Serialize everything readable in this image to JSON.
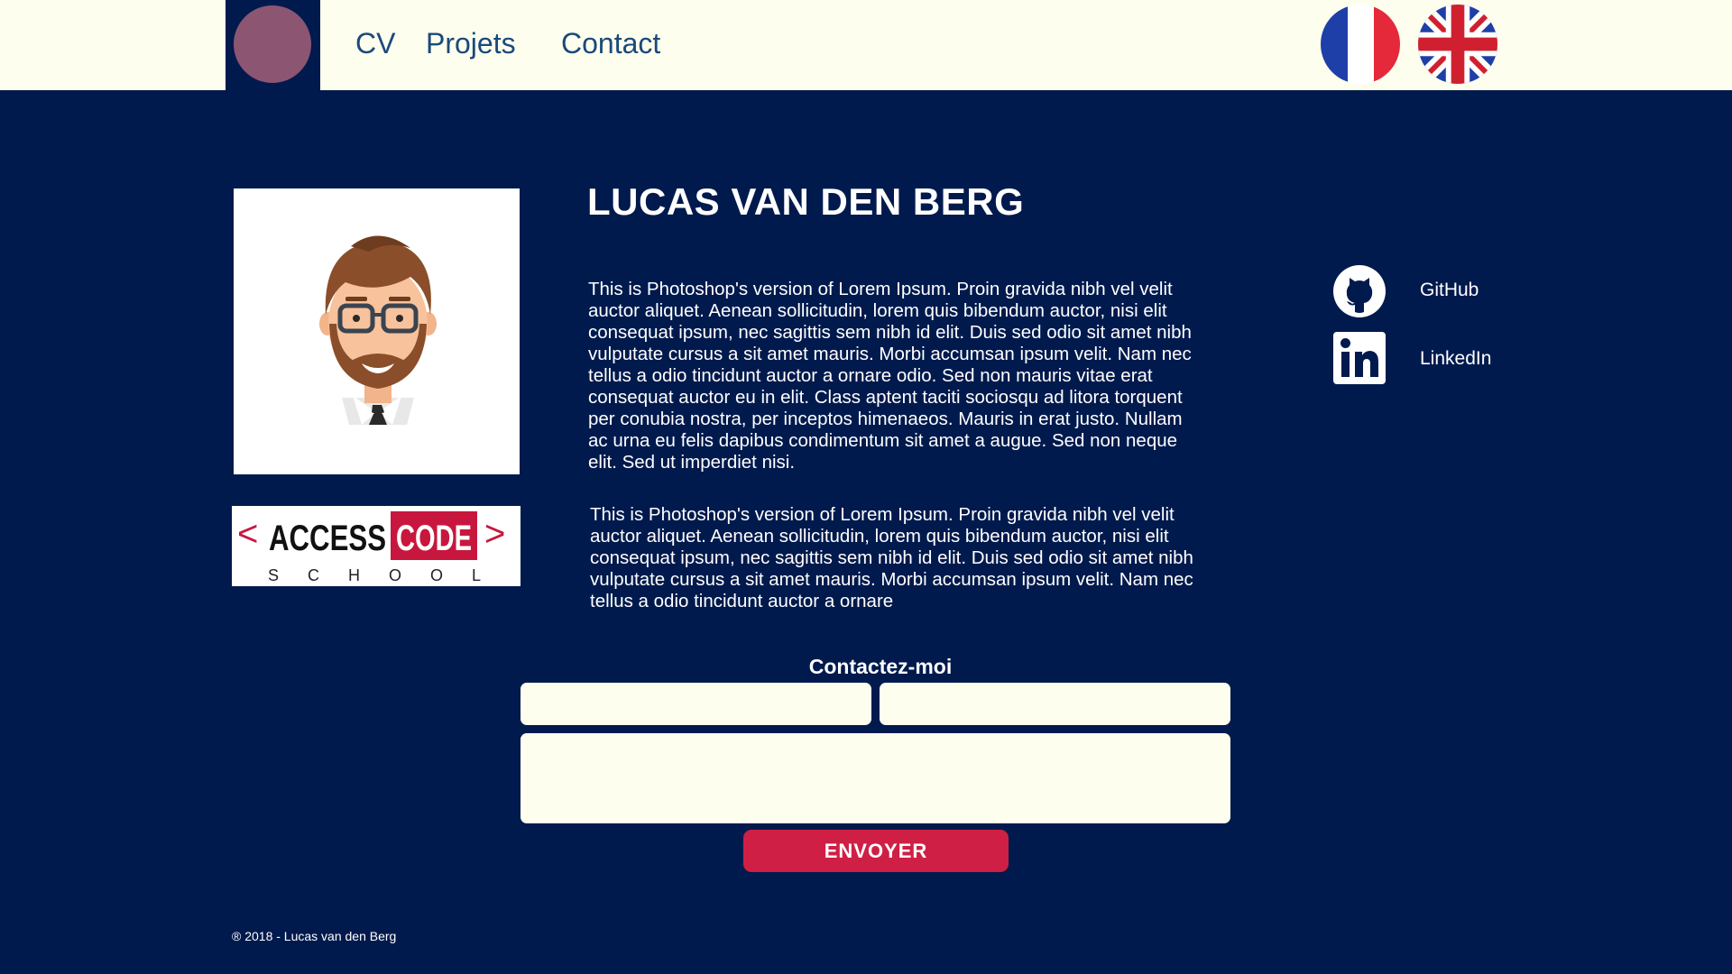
{
  "nav": {
    "items": [
      {
        "label": "CV"
      },
      {
        "label": "Projets"
      },
      {
        "label": "Contact"
      }
    ],
    "languages": [
      "fr-flag-icon",
      "uk-flag-icon"
    ]
  },
  "profile": {
    "name": "LUCAS VAN DEN BERG",
    "paragraph_1": "This is Photoshop's version  of Lorem Ipsum. Proin gravida nibh vel velit auctor aliquet. Aenean sollicitudin, lorem quis bibendum auctor, nisi elit consequat ipsum, nec sagittis sem nibh id elit. Duis sed odio sit amet nibh vulputate cursus a sit amet mauris. Morbi accumsan ipsum velit. Nam nec tellus a odio tincidunt auctor a ornare odio. Sed non  mauris vitae erat consequat auctor eu in elit. Class aptent taciti sociosqu ad litora torquent per conubia nostra, per inceptos himenaeos. Mauris in erat justo. Nullam ac urna eu felis dapibus condimentum sit amet a augue. Sed non neque elit. Sed ut imperdiet nisi.",
    "paragraph_2": "This is Photoshop's version  of Lorem Ipsum. Proin gravida nibh vel velit auctor aliquet. Aenean sollicitudin, lorem quis bibendum auctor, nisi elit consequat ipsum, nec sagittis sem nibh id elit. Duis sed odio sit amet nibh vulputate cursus a sit amet mauris. Morbi accumsan ipsum velit. Nam nec tellus a odio tincidunt auctor a ornare"
  },
  "school_logo": {
    "word1": "ACCESS",
    "word2": "CODE",
    "word3": "S C H O O L"
  },
  "social": {
    "github": {
      "label": "GitHub",
      "icon": "github-icon"
    },
    "linkedin": {
      "label": "LinkedIn",
      "icon": "linkedin-icon"
    }
  },
  "contact": {
    "title": "Contactez-moi",
    "name_placeholder": "",
    "email_placeholder": "",
    "message_placeholder": "",
    "submit_label": "ENVOYER"
  },
  "footer": {
    "text": "® 2018 - Lucas van den Berg"
  },
  "colors": {
    "background": "#001a4d",
    "topbar": "#fefeef",
    "accent": "#d01f45",
    "logo_circle": "#8c5572",
    "nav_text": "#1a4a7a"
  }
}
